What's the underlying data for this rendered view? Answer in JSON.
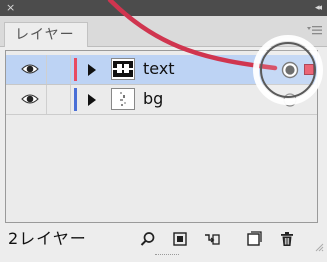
{
  "panel": {
    "close_glyph": "×",
    "collapse_glyph": "◂◂",
    "tab_label": "レイヤー"
  },
  "layers": [
    {
      "name": "text",
      "color": "#e84a5f",
      "selected": true
    },
    {
      "name": "bg",
      "color": "#4a6fd6",
      "selected": false
    }
  ],
  "footer": {
    "count_label": "2レイヤー"
  },
  "colors": {
    "annotation": "#d0354f",
    "selection": "#bdd3f4",
    "text_layer": "#e84a5f",
    "bg_layer": "#4a6fd6"
  }
}
